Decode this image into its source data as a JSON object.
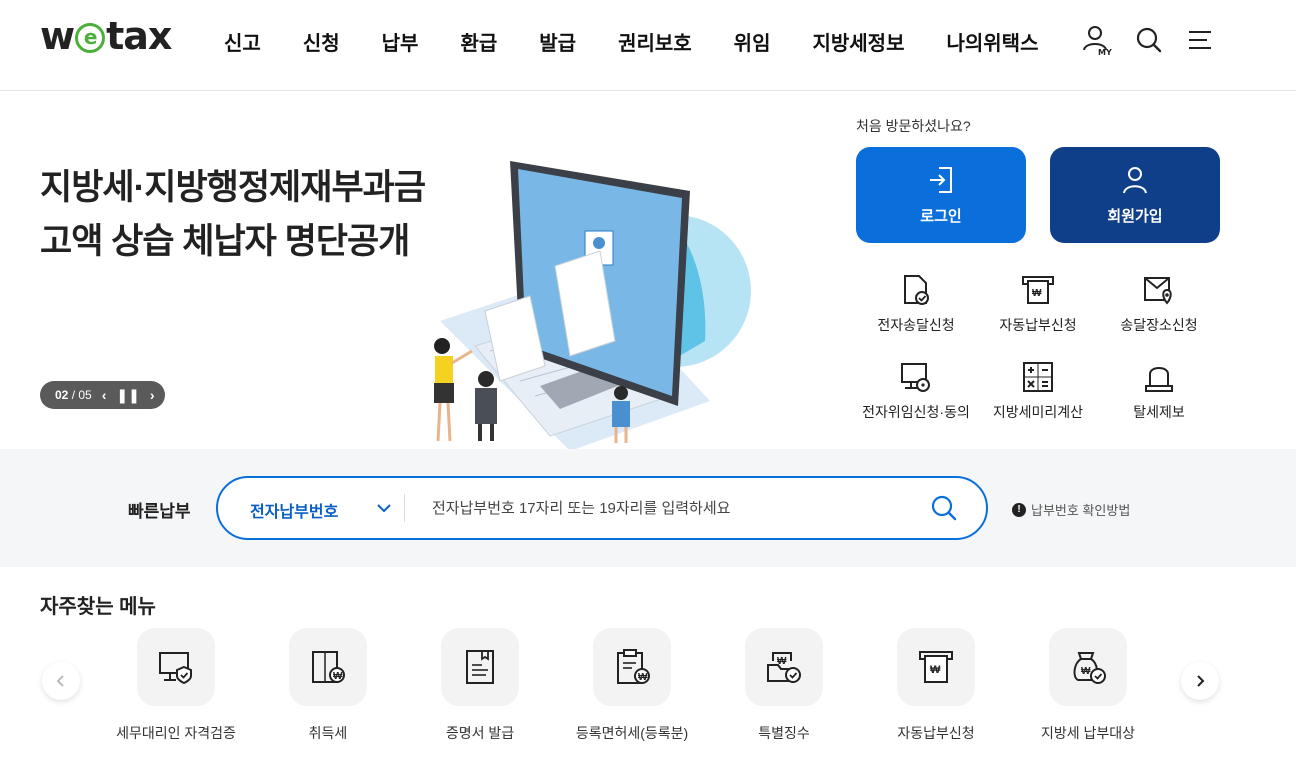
{
  "header": {
    "logo": {
      "pre": "w",
      "mid": "e",
      "post": "tax"
    },
    "nav": [
      "신고",
      "신청",
      "납부",
      "환급",
      "발급",
      "권리보호",
      "위임",
      "지방세정보",
      "나의위택스"
    ],
    "my_label": "MY"
  },
  "visual": {
    "slogan_line1": "지방세·지방행정제재부과금",
    "slogan_line2": "고액 상습 체납자 명단공개",
    "slide_current": "02",
    "slide_total": "05"
  },
  "login_panel": {
    "question": "처음 방문하셨나요?",
    "login_label": "로그인",
    "join_label": "회원가입",
    "colors": {
      "login": "#0a6fdb",
      "join": "#0f3f88"
    },
    "quick_links": [
      {
        "label": "전자송달신청",
        "icon": "e-delivery-icon"
      },
      {
        "label": "자동납부신청",
        "icon": "auto-pay-icon"
      },
      {
        "label": "송달장소신청",
        "icon": "delivery-place-icon"
      },
      {
        "label": "전자위임신청·동의",
        "icon": "e-delegation-icon"
      },
      {
        "label": "지방세미리계산",
        "icon": "calculator-icon"
      },
      {
        "label": "탈세제보",
        "icon": "report-siren-icon"
      }
    ]
  },
  "fastpay": {
    "title": "빠른납부",
    "select_value": "전자납부번호",
    "placeholder": "전자납부번호 17자리 또는 19자리를 입력하세요",
    "help_mark": "!",
    "help_label": "납부번호 확인방법"
  },
  "favorites": {
    "title": "자주찾는 메뉴",
    "items": [
      {
        "label": "세무대리인 자격검증",
        "icon": "verify-agent-icon"
      },
      {
        "label": "취득세",
        "icon": "acquisition-tax-icon"
      },
      {
        "label": "증명서 발급",
        "icon": "certificate-icon"
      },
      {
        "label": "등록면허세(등록분)",
        "icon": "registration-tax-icon"
      },
      {
        "label": "특별징수",
        "icon": "special-collection-icon"
      },
      {
        "label": "자동납부신청",
        "icon": "auto-pay-icon"
      },
      {
        "label": "지방세 납부대상",
        "icon": "tax-target-icon"
      }
    ]
  }
}
